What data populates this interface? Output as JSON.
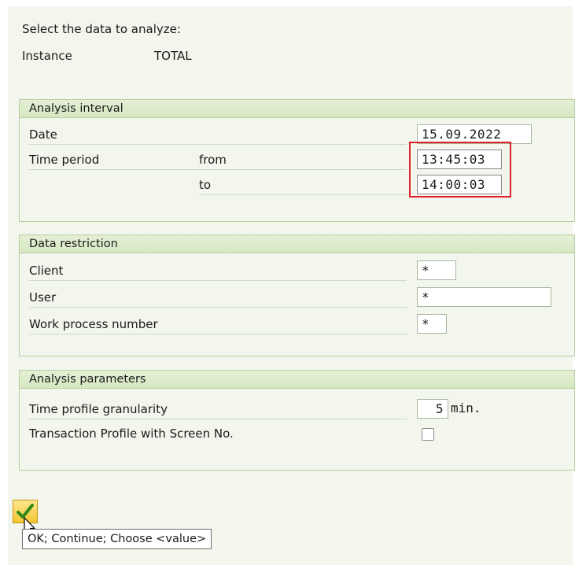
{
  "header": {
    "prompt": "Select the data to analyze:",
    "instance_label": "Instance",
    "instance_value": "TOTAL"
  },
  "analysis_interval": {
    "title": "Analysis interval",
    "date_label": "Date",
    "date_value": "15.09.2022",
    "time_period_label": "Time period",
    "from_label": "from",
    "from_value": "13:45:03",
    "to_label": "to",
    "to_value": "14:00:03"
  },
  "data_restriction": {
    "title": "Data restriction",
    "client_label": "Client",
    "client_value": "*",
    "user_label": "User",
    "user_value": "*",
    "work_process_label": "Work process number",
    "work_process_value": "*"
  },
  "analysis_parameters": {
    "title": "Analysis parameters",
    "granularity_label": "Time profile granularity",
    "granularity_value": "5",
    "granularity_unit": "min.",
    "screen_no_label": "Transaction Profile with Screen No.",
    "screen_no_checked": false
  },
  "footer": {
    "ok_tooltip": "OK; Continue; Choose <value>"
  },
  "colors": {
    "highlight": "#e0202a",
    "group_header": "#d6e7c1",
    "background": "#f2f6ec"
  }
}
